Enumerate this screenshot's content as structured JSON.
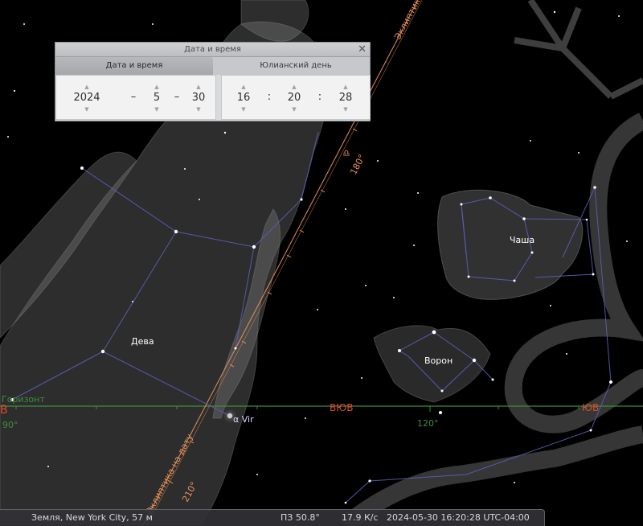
{
  "sky": {
    "labels": {
      "ecliptic": "Эклиптика",
      "ecliptic_of_date": "Эклиптика на дату",
      "horizon": "Горизонт",
      "virgo": "Дева",
      "crater": "Чаша",
      "corvus": "Ворон",
      "alpha_vir": "α Vir",
      "libra_symbol": "♎",
      "deg_180": "180°",
      "deg_210": "210°",
      "deg_120": "120°",
      "deg_90": "90°",
      "compass_esе": "ВЮВ",
      "compass_se": "ЮВ",
      "compass_e": "В"
    }
  },
  "dialog": {
    "title": "Дата и время",
    "close": "✕",
    "tabs": [
      "Дата и время",
      "Юлианский день"
    ],
    "date": {
      "year": "2024",
      "month": "5",
      "day": "30",
      "sep": "–"
    },
    "time": {
      "hour": "16",
      "minute": "20",
      "second": "28",
      "sep": ":"
    }
  },
  "status": {
    "location": "Земля, New York City, 57 м",
    "fov": "ПЗ 50.8°",
    "fps": "17.9 К/с",
    "datetime": "2024-05-30 16:20:28 UTC-04:00"
  },
  "colors": {
    "constellation_lines": "#5a5fb8",
    "ecliptic": "#e8935a",
    "horizon": "#3e8f3a",
    "compass": "#e04a2a",
    "labels": "#ffffff"
  }
}
